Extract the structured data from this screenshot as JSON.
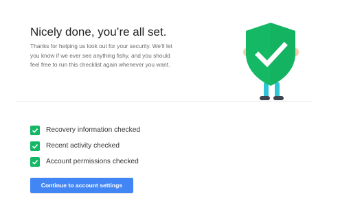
{
  "headline": "Nicely done, you’re all set.",
  "description_lines": [
    "Thanks for helping us look out for your security. We’ll let",
    "you know if we ever see anything fishy, and you should",
    "feel free to run this checklist again whenever you want."
  ],
  "illustration": {
    "icon": "shield-checkmark-icon",
    "colors": {
      "shield": "#14b865",
      "check": "#ffffff",
      "hands": "#f6c9a8",
      "legs": "#2ec5d6",
      "shoes": "#3d4450"
    }
  },
  "checklist": [
    {
      "label": "Recovery information checked",
      "icon": "checkbox-checked-icon"
    },
    {
      "label": "Recent activity checked",
      "icon": "checkbox-checked-icon"
    },
    {
      "label": "Account permissions checked",
      "icon": "checkbox-checked-icon"
    }
  ],
  "checkbox_color": "#12b866",
  "cta": {
    "label": "Continue to account settings",
    "color": "#4285f4"
  }
}
